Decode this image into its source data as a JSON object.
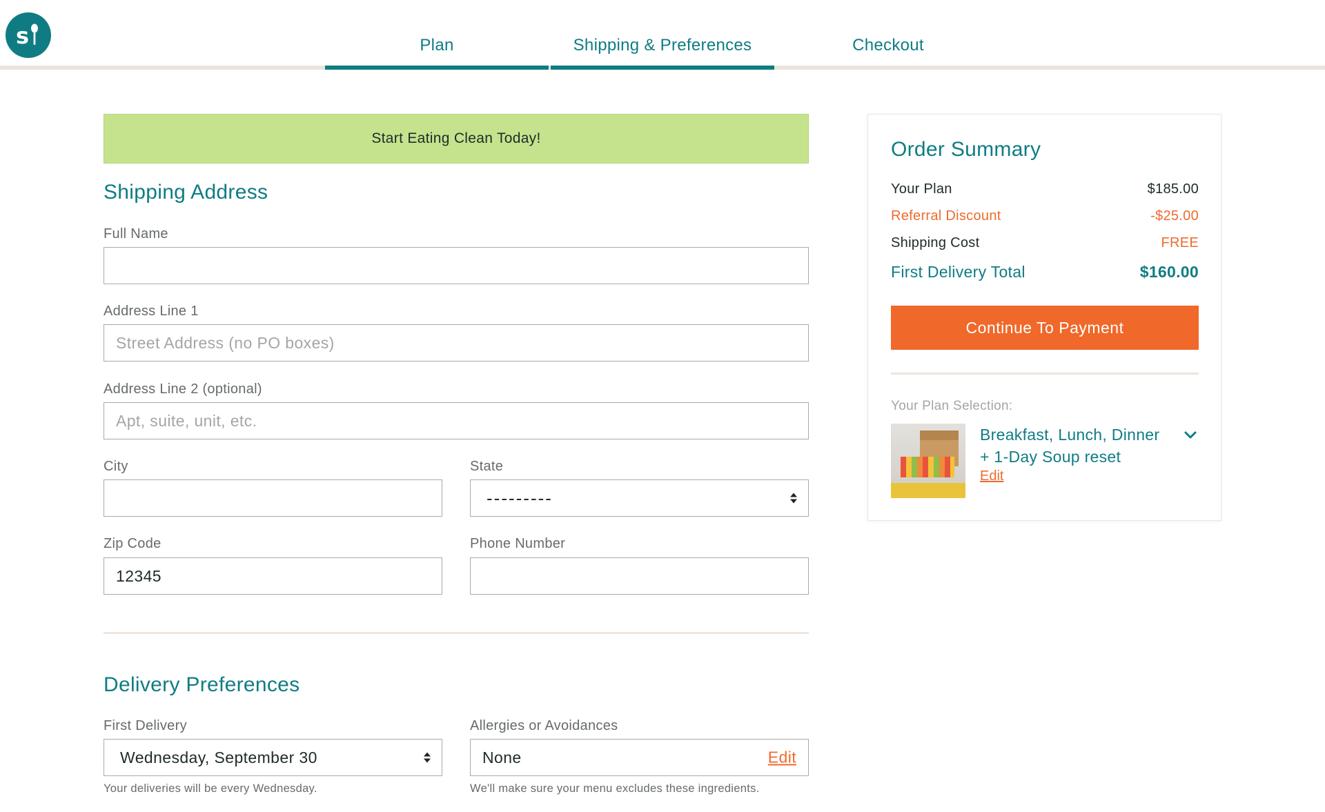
{
  "brand": {
    "logo_text": "s",
    "accent": "#0f7c84",
    "orange": "#ef6a2d",
    "banner_color": "#c5e38c"
  },
  "steps": [
    {
      "label": "Plan",
      "active": true
    },
    {
      "label": "Shipping & Preferences",
      "active": true
    },
    {
      "label": "Checkout",
      "active": false
    }
  ],
  "banner": {
    "text": "Start Eating Clean Today!"
  },
  "shipping": {
    "title": "Shipping Address",
    "full_name": {
      "label": "Full Name",
      "value": "",
      "placeholder": ""
    },
    "address1": {
      "label": "Address Line 1",
      "value": "",
      "placeholder": "Street Address (no PO boxes)"
    },
    "address2": {
      "label": "Address Line 2 (optional)",
      "value": "",
      "placeholder": "Apt, suite, unit, etc."
    },
    "city": {
      "label": "City",
      "value": ""
    },
    "state": {
      "label": "State",
      "value": "---------"
    },
    "zip": {
      "label": "Zip Code",
      "value": "12345"
    },
    "phone": {
      "label": "Phone Number",
      "value": ""
    }
  },
  "delivery": {
    "title": "Delivery Preferences",
    "first_delivery": {
      "label": "First Delivery",
      "value": "Wednesday, September 30",
      "help": "Your deliveries will be every Wednesday."
    },
    "allergies": {
      "label": "Allergies or Avoidances",
      "value": "None",
      "edit": "Edit",
      "help": "We'll make sure your menu excludes these ingredients."
    }
  },
  "summary": {
    "title": "Order Summary",
    "plan": {
      "label": "Your Plan",
      "value": "$185.00"
    },
    "discount": {
      "label": "Referral Discount",
      "value": "-$25.00"
    },
    "shipping": {
      "label": "Shipping Cost",
      "value": "FREE"
    },
    "total": {
      "label": "First Delivery Total",
      "value": "$160.00"
    },
    "cta": "Continue To Payment",
    "plan_selection_label": "Your Plan Selection:",
    "plan_name_line1": "Breakfast, Lunch, Dinner",
    "plan_name_line2": "+ 1-Day Soup reset",
    "plan_edit": "Edit"
  }
}
